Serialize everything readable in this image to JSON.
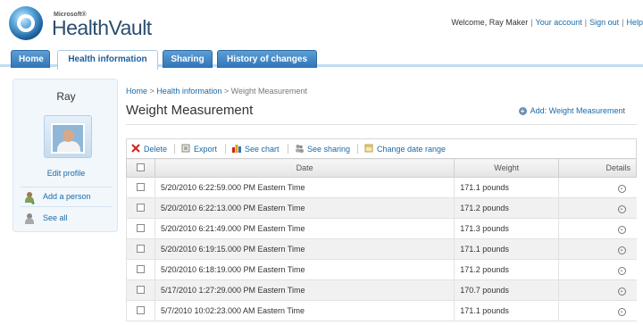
{
  "header": {
    "logo_microsoft": "Microsoft®",
    "logo_text": "HealthVault",
    "welcome": "Welcome, Ray Maker",
    "your_account": "Your account",
    "sign_out": "Sign out",
    "help": "Help"
  },
  "tabs": [
    {
      "label": "Home"
    },
    {
      "label": "Health information"
    },
    {
      "label": "Sharing"
    },
    {
      "label": "History of changes"
    }
  ],
  "sidebar": {
    "name": "Ray",
    "edit_profile": "Edit profile",
    "add_person": "Add a person",
    "see_all": "See all"
  },
  "breadcrumb": {
    "home": "Home",
    "health_information": "Health information",
    "sep": ">",
    "current": "Weight Measurement"
  },
  "main": {
    "title": "Weight Measurement",
    "add_link": "Add: Weight Measurement"
  },
  "toolbar": {
    "delete": "Delete",
    "export": "Export",
    "see_chart": "See chart",
    "see_sharing": "See sharing",
    "change_date_range": "Change date range"
  },
  "table": {
    "columns": [
      "Date",
      "Weight",
      "Details"
    ],
    "rows": [
      {
        "date": "5/20/2010 6:22:59.000 PM Eastern Time",
        "weight": "171.1 pounds"
      },
      {
        "date": "5/20/2010 6:22:13.000 PM Eastern Time",
        "weight": "171.2 pounds"
      },
      {
        "date": "5/20/2010 6:21:49.000 PM Eastern Time",
        "weight": "171.3 pounds"
      },
      {
        "date": "5/20/2010 6:19:15.000 PM Eastern Time",
        "weight": "171.1 pounds"
      },
      {
        "date": "5/20/2010 6:18:19.000 PM Eastern Time",
        "weight": "171.2 pounds"
      },
      {
        "date": "5/17/2010 1:27:29.000 PM Eastern Time",
        "weight": "170.7 pounds"
      },
      {
        "date": "5/7/2010 10:02:23.000 AM Eastern Time",
        "weight": "171.1 pounds"
      }
    ]
  },
  "colors": {
    "tab_blue": "#2f74b7",
    "link_blue": "#1a6aa8"
  }
}
